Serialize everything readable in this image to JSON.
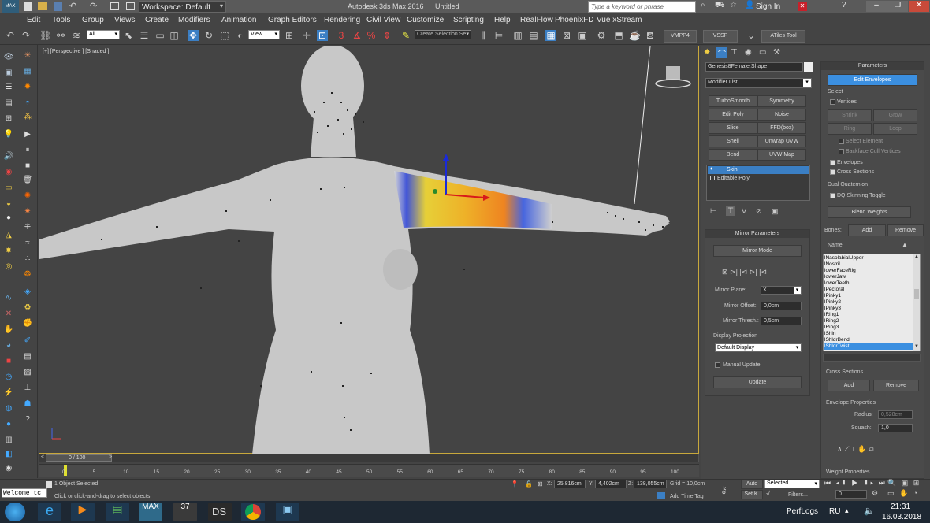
{
  "title": {
    "workspace": "Workspace: Default",
    "app": "Autodesk 3ds Max 2016",
    "doc": "Untitled",
    "search_placeholder": "Type a keyword or phrase",
    "sign_in": "Sign In"
  },
  "menu": [
    "Edit",
    "Tools",
    "Group",
    "Views",
    "Create",
    "Modifiers",
    "Animation",
    "Graph Editors",
    "Rendering",
    "Civil View",
    "Customize",
    "Scripting",
    "Help",
    "RealFlow",
    "PhoenixFD",
    "Vue xStream"
  ],
  "toolbar": {
    "filter": "All",
    "view": "View",
    "selection_set": "Create Selection Se",
    "vmpp": "VMPP4",
    "vssp": "VSSP",
    "atiles": "ATiles Tool"
  },
  "viewport": {
    "label": "[+] [Perspective ] [Shaded ]"
  },
  "command_panel": {
    "object_name": "Genesis8Female.Shape",
    "modifier_list": "Modifier List",
    "mod_buttons": [
      "TurboSmooth",
      "Symmetry",
      "Edit Poly",
      "Noise",
      "Slice",
      "FFD(box)",
      "Shell",
      "Unwrap UVW",
      "Bend",
      "UVW Map"
    ],
    "stack": [
      "Skin",
      "Editable Poly"
    ],
    "mirror": {
      "title": "Mirror Parameters",
      "mode": "Mirror Mode",
      "plane_label": "Mirror Plane:",
      "plane_value": "X",
      "offset_label": "Mirror Offset:",
      "offset_value": "0,0cm",
      "thresh_label": "Mirror Thresh.:",
      "thresh_value": "0,5cm",
      "display_projection": "Display Projection",
      "projection_value": "Default Display",
      "manual_update": "Manual Update",
      "update": "Update"
    }
  },
  "parameters": {
    "title": "Parameters",
    "edit_envelopes": "Edit Envelopes",
    "select": "Select",
    "vertices": "Vertices",
    "shrink": "Shrink",
    "grow": "Grow",
    "ring": "Ring",
    "loop": "Loop",
    "select_element": "Select Element",
    "backface": "Backface Cull Vertices",
    "envelopes": "Envelopes",
    "cross_sections": "Cross Sections",
    "dual_quaternion": "Dual Quaternion",
    "dq_toggle": "DQ Skinning Toggle",
    "blend_weights": "Blend Weights",
    "bones": "Bones:",
    "add": "Add",
    "remove": "Remove",
    "name": "Name",
    "bone_list": [
      "lNasolabialUpper",
      "lNostril",
      "lowerFaceRig",
      "lowerJaw",
      "lowerTeeth",
      "lPectoral",
      "lPinky1",
      "lPinky2",
      "lPinky3",
      "lRing1",
      "lRing2",
      "lRing3",
      "lShin",
      "lShldrBend",
      "lShldrTwist"
    ],
    "cross_sections_title": "Cross Sections",
    "cs_add": "Add",
    "cs_remove": "Remove",
    "envelope_props": "Envelope Properties",
    "radius_label": "Radius:",
    "radius_value": "0,528cm",
    "squash_label": "Squash:",
    "squash_value": "1,0",
    "weight_props": "Weight Properties"
  },
  "timeline": {
    "frame": "0 / 100",
    "ticks": [
      "0",
      "5",
      "10",
      "15",
      "20",
      "25",
      "30",
      "35",
      "40",
      "45",
      "50",
      "55",
      "60",
      "65",
      "70",
      "75",
      "80",
      "85",
      "90",
      "95",
      "100"
    ]
  },
  "status": {
    "welcome": "Welcome tc",
    "selected": "1 Object Selected",
    "prompt": "Click or click-and-drag to select objects",
    "x_label": "X:",
    "x_value": "25,816cm",
    "y_label": "Y:",
    "y_value": "4,402cm",
    "z_label": "Z:",
    "z_value": "138,055cm",
    "grid": "Grid = 10,0cm",
    "add_time_tag": "Add Time Tag",
    "auto": "Auto",
    "set_k": "Set K.",
    "selected_dd": "Selected",
    "filters": "Filters...",
    "frame_field": "0"
  },
  "taskbar": {
    "perflogs": "PerfLogs",
    "lang": "RU",
    "time": "21:31",
    "date": "16.03.2018",
    "ds_label": "DS"
  }
}
